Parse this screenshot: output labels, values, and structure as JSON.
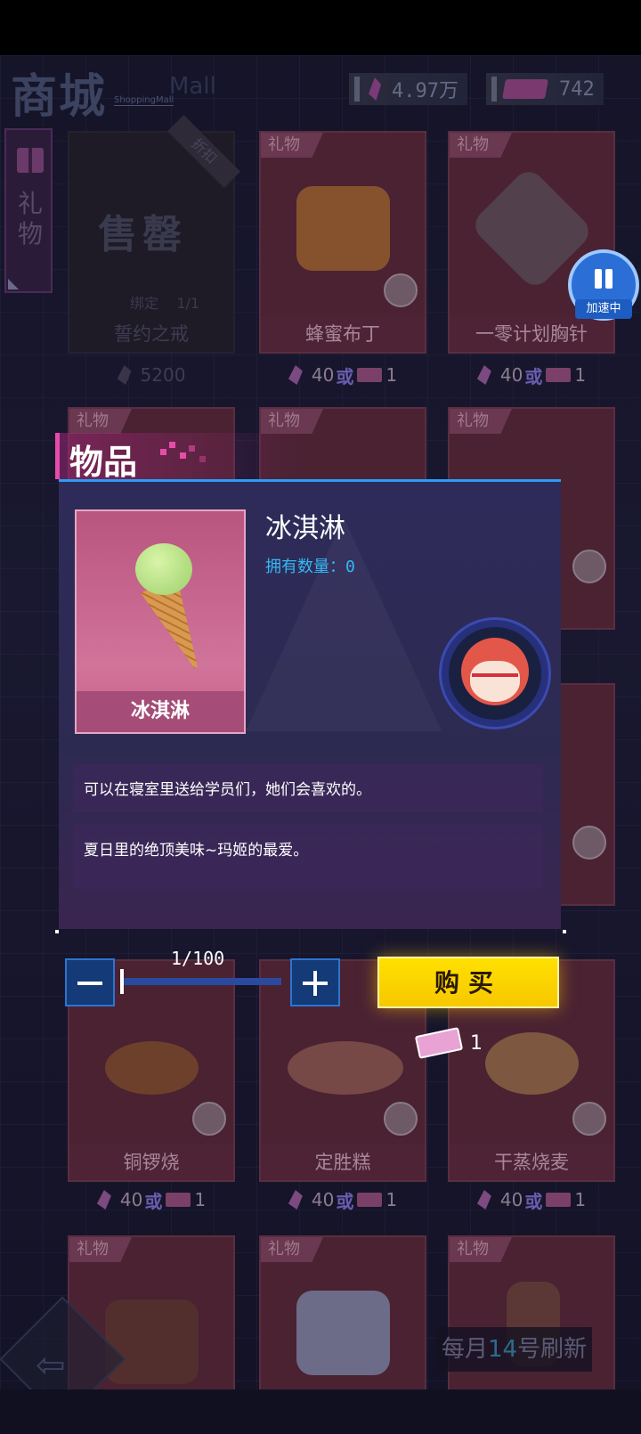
{
  "header": {
    "title": "商城",
    "subtitle": "ShoppingMall",
    "ghost_text": "Mall",
    "crystal_count": "4.97万",
    "ticket_count": "742"
  },
  "side_tab": {
    "label": "礼物"
  },
  "badge": {
    "label": "加速中"
  },
  "shop": {
    "tag": "礼物",
    "or_text": "或",
    "sold_card": {
      "stamp": "售罄",
      "discount": "折扣",
      "bound": "绑定",
      "bound_count": "1/1",
      "name": "誓约之戒",
      "price": "5200"
    },
    "cards": [
      {
        "name": "蜂蜜布丁",
        "price": "40",
        "tickets": "1"
      },
      {
        "name": "一零计划胸针",
        "price": "40",
        "tickets": "1"
      },
      {
        "name": "铜锣烧",
        "price": "40",
        "tickets": "1"
      },
      {
        "name": "定胜糕",
        "price": "40",
        "tickets": "1"
      },
      {
        "name": "干蒸烧麦",
        "price": "40",
        "tickets": "1"
      }
    ]
  },
  "modal": {
    "title": "物品",
    "item_name": "冰淇淋",
    "frame_label": "冰淇淋",
    "owned_label": "拥有数量：",
    "owned_value": "0",
    "desc1": "可以在寝室里送给学员们，她们会喜欢的。",
    "desc2": "夏日里的绝顶美味~玛姬的最爱。"
  },
  "purchase": {
    "quantity": "1/100",
    "buy_label": "购买",
    "cost": "1"
  },
  "footer": {
    "refresh_pre": "每月",
    "refresh_day": "14",
    "refresh_post": "号刷新",
    "back_arrow": "⇦"
  },
  "colors": {
    "accent_blue": "#2a9df4",
    "buy_yellow": "#ffe000",
    "title_pink": "#e54ba9"
  }
}
